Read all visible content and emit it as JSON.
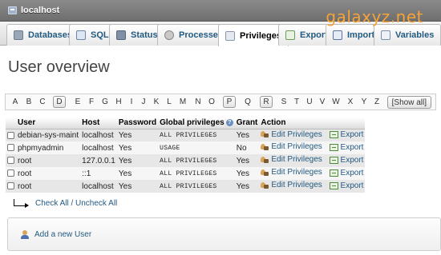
{
  "header": {
    "server_name": "localhost",
    "watermark": "galaxyz.net"
  },
  "tabs": [
    {
      "label": "Databases",
      "icon": "database-icon"
    },
    {
      "label": "SQL",
      "icon": "sql-icon"
    },
    {
      "label": "Status",
      "icon": "status-icon"
    },
    {
      "label": "Processes",
      "icon": "processes-icon"
    },
    {
      "label": "Privileges",
      "icon": "privileges-icon",
      "active": true
    },
    {
      "label": "Export",
      "icon": "export-icon"
    },
    {
      "label": "Import",
      "icon": "import-icon"
    },
    {
      "label": "Variables",
      "icon": "variables-icon"
    }
  ],
  "page_title": "User overview",
  "alphabet": {
    "letters": [
      "A",
      "B",
      "C",
      "D",
      "E",
      "F",
      "G",
      "H",
      "I",
      "J",
      "K",
      "L",
      "M",
      "N",
      "O",
      "P",
      "Q",
      "R",
      "S",
      "T",
      "U",
      "V",
      "W",
      "X",
      "Y",
      "Z"
    ],
    "highlighted": [
      "D",
      "P",
      "R"
    ],
    "show_all": "[Show all]"
  },
  "table": {
    "headers": {
      "user": "User",
      "host": "Host",
      "password": "Password",
      "global_privileges": "Global privileges",
      "grant": "Grant",
      "action": "Action"
    },
    "rows": [
      {
        "user": "debian-sys-maint",
        "host": "localhost",
        "password": "Yes",
        "privileges": "ALL PRIVILEGES",
        "grant": "Yes"
      },
      {
        "user": "phpmyadmin",
        "host": "localhost",
        "password": "Yes",
        "privileges": "USAGE",
        "grant": "No"
      },
      {
        "user": "root",
        "host": "127.0.0.1",
        "password": "Yes",
        "privileges": "ALL PRIVILEGES",
        "grant": "Yes"
      },
      {
        "user": "root",
        "host": "::1",
        "password": "Yes",
        "privileges": "ALL PRIVILEGES",
        "grant": "Yes"
      },
      {
        "user": "root",
        "host": "localhost",
        "password": "Yes",
        "privileges": "ALL PRIVILEGES",
        "grant": "Yes"
      }
    ],
    "actions": {
      "edit": "Edit Privileges",
      "export": "Export"
    }
  },
  "check_all": "Check All / Uncheck All",
  "add_user": "Add a new User"
}
